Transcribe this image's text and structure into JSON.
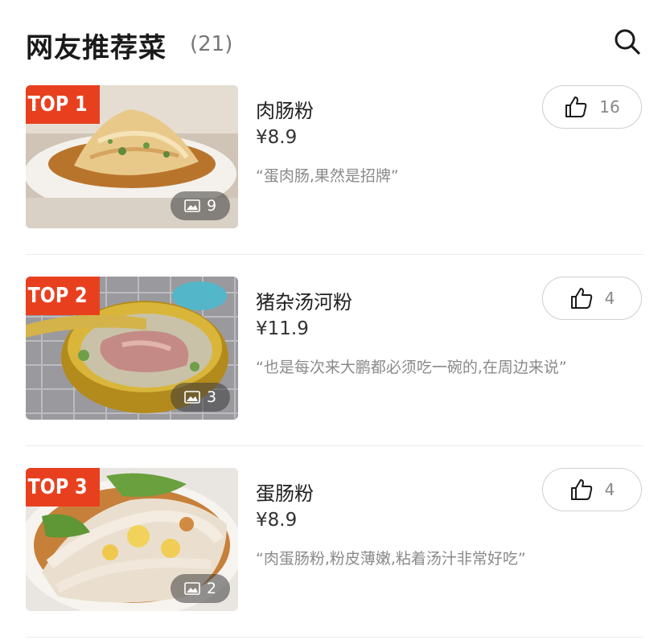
{
  "header": {
    "title": "网友推荐菜",
    "count": "(21)",
    "search_icon": "search-icon"
  },
  "dishes": [
    {
      "rank": "TOP 1",
      "name": "肉肠粉",
      "price": "¥8.9",
      "quote": "“蛋肉肠,果然是招牌”",
      "likes": "16",
      "photo_count": "9"
    },
    {
      "rank": "TOP 2",
      "name": "猪杂汤河粉",
      "price": "¥11.9",
      "quote": "“也是每次来大鹏都必须吃一碗的,在周边来说”",
      "likes": "4",
      "photo_count": "3"
    },
    {
      "rank": "TOP 3",
      "name": "蛋肠粉",
      "price": "¥8.9",
      "quote": "“肉蛋肠粉,粉皮薄嫩,粘着汤汁非常好吃”",
      "likes": "4",
      "photo_count": "2"
    }
  ],
  "colors": {
    "badge": "#e8401f",
    "title": "#1a1a1a",
    "quote": "#8a8a8a"
  }
}
